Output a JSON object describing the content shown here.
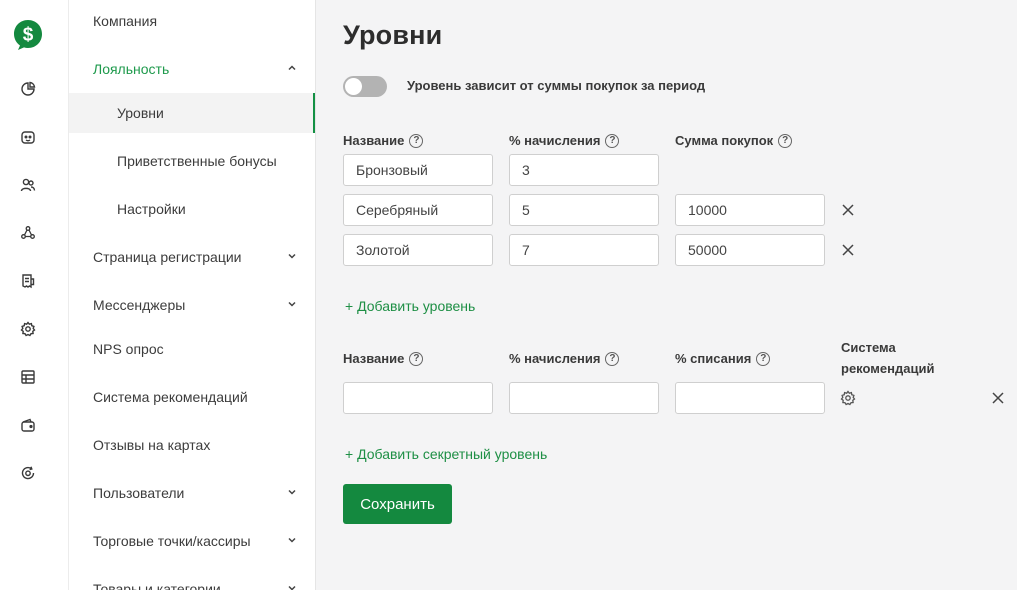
{
  "brand": {
    "logo_icon": "dollar-bubble-icon",
    "accent": "#14893f"
  },
  "rail": {
    "icons": [
      "chart-pie-icon",
      "robot-face-icon",
      "users-icon",
      "network-icon",
      "receipt-icon",
      "settings-icon",
      "table-icon",
      "wallet-icon",
      "currency-cycle-icon"
    ]
  },
  "sidebar": {
    "items": [
      {
        "label": "Компания"
      },
      {
        "label": "Лояльность"
      },
      {
        "label": "Уровни"
      },
      {
        "label": "Приветственные бонусы"
      },
      {
        "label": "Настройки"
      },
      {
        "label": "Страница регистрации"
      },
      {
        "label": "Мессенджеры"
      },
      {
        "label": "NPS опрос"
      },
      {
        "label": "Система рекомендаций"
      },
      {
        "label": "Отзывы на картах"
      },
      {
        "label": "Пользователи"
      },
      {
        "label": "Торговые точки/кассиры"
      },
      {
        "label": "Товары и категории"
      }
    ]
  },
  "page": {
    "title": "Уровни"
  },
  "toggle": {
    "label": "Уровень зависит от суммы покупок за период",
    "on": false
  },
  "levels": {
    "headers": {
      "name": "Название",
      "accrual": "% начисления",
      "sum": "Сумма покупок"
    },
    "rows": [
      {
        "name": "Бронзовый",
        "accrual": "3",
        "sum": null
      },
      {
        "name": "Серебряный",
        "accrual": "5",
        "sum": "10000"
      },
      {
        "name": "Золотой",
        "accrual": "7",
        "sum": "50000"
      }
    ],
    "add_label": "+ Добавить уровень"
  },
  "secret_levels": {
    "headers": {
      "name": "Название",
      "accrual": "% начисления",
      "writeoff": "% списания",
      "system_line1": "Система",
      "system_line2": "рекомендаций"
    },
    "rows": [
      {
        "name": "",
        "accrual": "",
        "writeoff": ""
      }
    ],
    "add_label": "+ Добавить секретный уровень"
  },
  "actions": {
    "save_label": "Сохранить"
  }
}
